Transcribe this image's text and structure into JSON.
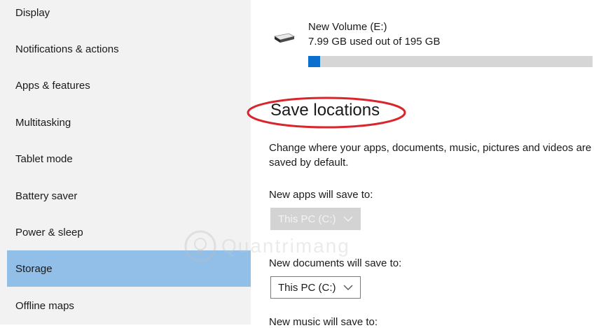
{
  "sidebar": {
    "items": [
      {
        "label": "Display"
      },
      {
        "label": "Notifications & actions"
      },
      {
        "label": "Apps & features"
      },
      {
        "label": "Multitasking"
      },
      {
        "label": "Tablet mode"
      },
      {
        "label": "Battery saver"
      },
      {
        "label": "Power & sleep"
      },
      {
        "label": "Storage",
        "selected": true
      },
      {
        "label": "Offline maps"
      }
    ]
  },
  "drive": {
    "name": "New Volume (E:)",
    "usage_text": "7.99 GB used out of 195 GB",
    "used_fraction": 0.041,
    "bar_color": "#0a6fce",
    "icon": "drive-icon"
  },
  "save_locations": {
    "title": "Save locations",
    "description": "Change where your apps, documents, music, pictures and videos are saved by default.",
    "new_apps": {
      "label": "New apps will save to:",
      "value": "This PC (C:)",
      "disabled": true
    },
    "new_documents": {
      "label": "New documents will save to:",
      "value": "This PC (C:)",
      "disabled": false
    },
    "next_label": "New music will save to:"
  },
  "watermark": {
    "text": "Quantrimang"
  },
  "colors": {
    "selected": "#91bfe8",
    "sidebar_bg": "#f2f2f2",
    "annotation": "#d9262c"
  }
}
